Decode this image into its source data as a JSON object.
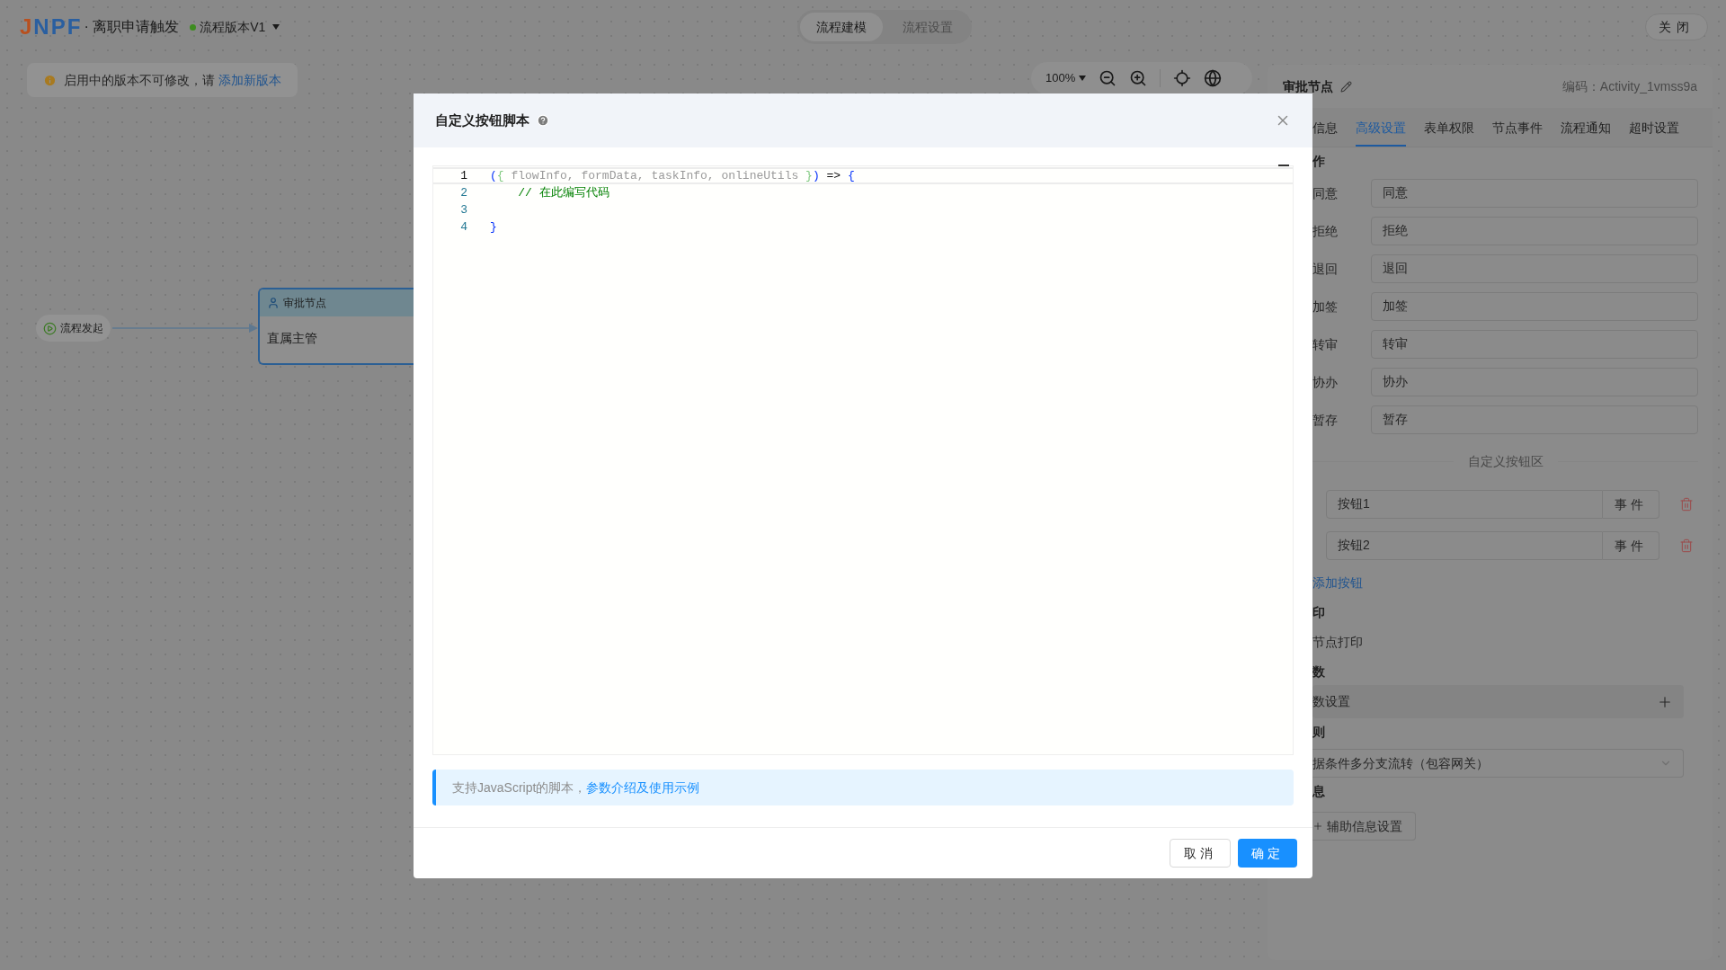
{
  "header": {
    "logo": "JNPF",
    "separator": "·",
    "title": "离职申请触发",
    "version": {
      "label": "流程版本V1",
      "active": true
    }
  },
  "mode_tabs": [
    {
      "label": "流程建模",
      "selected": true
    },
    {
      "label": "流程设置",
      "selected": false
    }
  ],
  "close_button": "关闭",
  "notice": {
    "text": "启用中的版本不可修改，请",
    "link": "添加新版本"
  },
  "zoom": {
    "value": "100%"
  },
  "canvas": {
    "nodes": [
      {
        "kind": "start",
        "label": "流程发起"
      },
      {
        "kind": "approval",
        "title": "审批节点",
        "body": "直属主管"
      }
    ]
  },
  "panel": {
    "title": "审批节点",
    "code": "编码：Activity_1vmss9a",
    "tabs": [
      {
        "label": "信息",
        "selected": false
      },
      {
        "label": "高级设置",
        "selected": true
      },
      {
        "label": "表单权限",
        "selected": false
      },
      {
        "label": "节点事件",
        "selected": false
      },
      {
        "label": "流程通知",
        "selected": false
      },
      {
        "label": "超时设置",
        "selected": false
      }
    ],
    "items": [
      {
        "kind": "heading",
        "text": "作"
      },
      {
        "kind": "field",
        "label": "同意",
        "value": "同意"
      },
      {
        "kind": "field",
        "label": "拒绝",
        "value": "拒绝"
      },
      {
        "kind": "field",
        "label": "退回",
        "value": "退回"
      },
      {
        "kind": "field",
        "label": "加签",
        "value": "加签"
      },
      {
        "kind": "field",
        "label": "转审",
        "value": "转审"
      },
      {
        "kind": "field",
        "label": "协办",
        "value": "协办"
      },
      {
        "kind": "field",
        "label": "暂存",
        "value": "暂存"
      },
      {
        "kind": "divider",
        "text": "自定义按钮区"
      },
      {
        "kind": "custom",
        "value": "按钮1",
        "action": "事件"
      },
      {
        "kind": "custom",
        "value": "按钮2",
        "action": "事件"
      },
      {
        "kind": "link",
        "text": "添加按钮"
      },
      {
        "kind": "heading",
        "text": "印"
      },
      {
        "kind": "text",
        "text": "节点打印"
      },
      {
        "kind": "heading",
        "text": "数"
      },
      {
        "kind": "expand",
        "text": "数设置"
      },
      {
        "kind": "heading",
        "text": "则"
      },
      {
        "kind": "select",
        "value": "据条件多分支流转（包容网关）"
      },
      {
        "kind": "heading",
        "text": "息"
      },
      {
        "kind": "button",
        "text": "辅助信息设置"
      }
    ]
  },
  "dialog": {
    "title": "自定义按钮脚本",
    "lines": [
      {
        "number": "1",
        "selected": true,
        "tokens": [
          {
            "text": "(",
            "kind": "paren"
          },
          {
            "text": "{",
            "kind": "brace"
          },
          {
            "text": " flowInfo, formData, taskInfo, onlineUtils ",
            "kind": "param"
          },
          {
            "text": "}",
            "kind": "brace"
          },
          {
            "text": ")",
            "kind": "paren"
          },
          {
            "text": " => ",
            "kind": "operator"
          },
          {
            "text": "{",
            "kind": "paren"
          }
        ]
      },
      {
        "number": "2",
        "selected": false,
        "tokens": [
          {
            "text": "    // 在此编写代码",
            "kind": "comment"
          }
        ]
      },
      {
        "number": "3",
        "selected": false
      },
      {
        "number": "4",
        "selected": false,
        "tokens": [
          {
            "text": "}",
            "kind": "paren"
          }
        ]
      }
    ],
    "hint": {
      "text": "支持JavaScript的脚本，",
      "link": "参数介绍及使用示例"
    },
    "buttons": [
      {
        "label": "取消",
        "kind": "default"
      },
      {
        "label": "确定",
        "kind": "primary"
      }
    ]
  }
}
